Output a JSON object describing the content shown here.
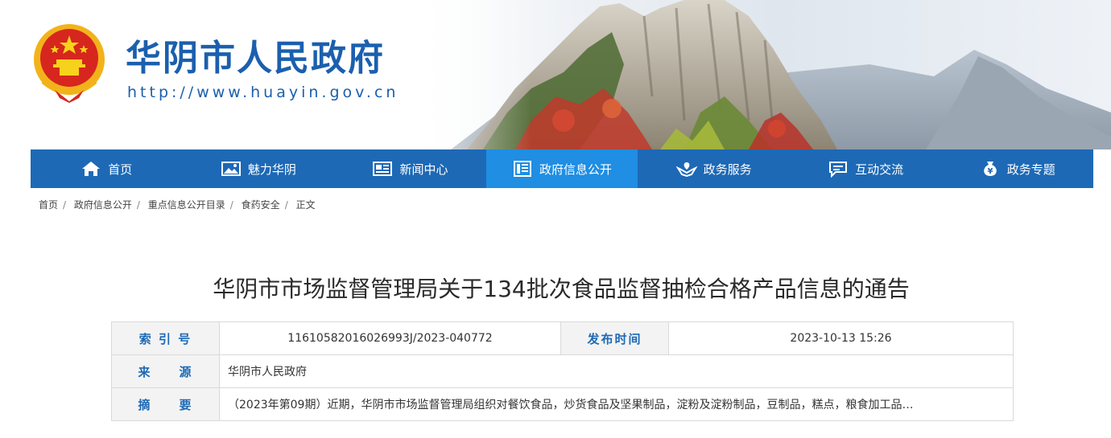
{
  "site": {
    "title": "华阴市人民政府",
    "url": "http://www.huayin.gov.cn"
  },
  "nav": {
    "items": [
      {
        "label": "首页",
        "icon": "home-icon"
      },
      {
        "label": "魅力华阴",
        "icon": "picture-icon"
      },
      {
        "label": "新闻中心",
        "icon": "newspaper-icon"
      },
      {
        "label": "政府信息公开",
        "icon": "document-list-icon",
        "active": true
      },
      {
        "label": "政务服务",
        "icon": "hands-service-icon"
      },
      {
        "label": "互动交流",
        "icon": "chat-icon"
      },
      {
        "label": "政务专题",
        "icon": "money-bag-icon"
      }
    ]
  },
  "breadcrumb": [
    "首页",
    "政府信息公开",
    "重点信息公开目录",
    "食药安全",
    "正文"
  ],
  "article": {
    "title": "华阴市市场监督管理局关于134批次食品监督抽检合格产品信息的通告"
  },
  "meta": {
    "index_label": "索 引 号",
    "index_value": "11610582016026993J/2023-040772",
    "date_label": "发布时间",
    "date_value": "2023-10-13 15:26",
    "source_label": "来　　源",
    "source_value": "华阴市人民政府",
    "summary_label": "摘　　要",
    "summary_value": "（2023年第09期）近期，华阴市市场监督管理局组织对餐饮食品，炒货食品及坚果制品，淀粉及淀粉制品，豆制品，糕点，粮食加工品…"
  },
  "colors": {
    "nav": "#1d69b6",
    "nav_active": "#1f8ee3",
    "title_blue": "#1b5fae"
  }
}
